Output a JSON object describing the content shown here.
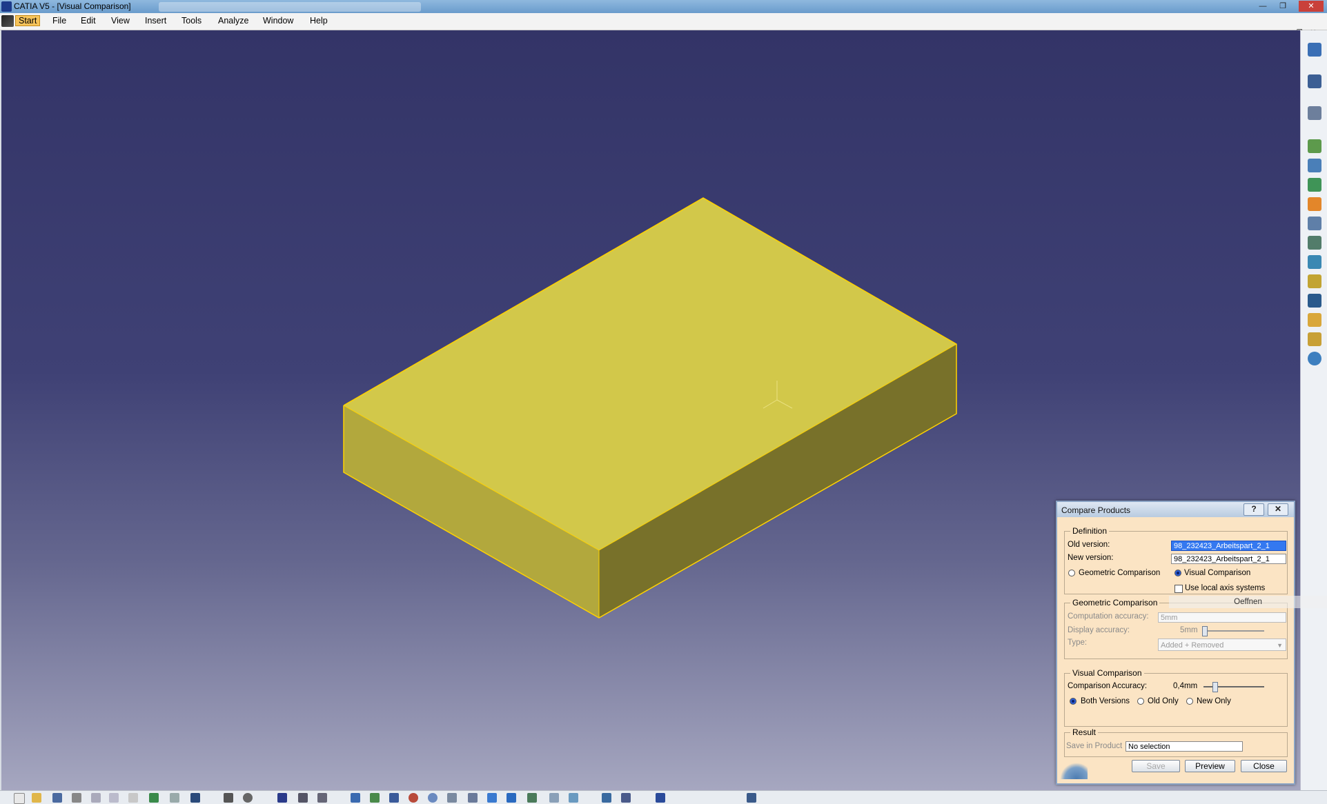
{
  "window": {
    "title": "CATIA V5 - [Visual Comparison]",
    "controls": {
      "minimize": "—",
      "maximize": "❐",
      "close": "✕"
    }
  },
  "menu": {
    "items": [
      "Start",
      "File",
      "Edit",
      "View",
      "Insert",
      "Tools",
      "Analyze",
      "Window",
      "Help"
    ]
  },
  "doc_controls": {
    "minimize": "–",
    "restore": "❐",
    "close": "✕"
  },
  "colors": {
    "viewport_top": "#333467",
    "viewport_bottom": "#a6a7c0",
    "part_top": "#d2c84a",
    "part_left": "#b2a83d",
    "part_right": "#78712a",
    "edge_highlight": "#ffd200"
  },
  "dialog": {
    "title": "Compare Products",
    "help_button": "?",
    "close_button": "✕",
    "definition": {
      "label": "Definition",
      "old_version_label": "Old version:",
      "old_version_value": "98_232423_Arbeitspart_2_1",
      "new_version_label": "New version:",
      "new_version_value": "98_232423_Arbeitspart_2_1",
      "geometric_option": "Geometric Comparison",
      "visual_option": "Visual Comparison",
      "selected_mode": "Visual Comparison",
      "local_axis_label": "Use local axis systems",
      "local_axis_checked": false
    },
    "geometric": {
      "label": "Geometric Comparison",
      "computation_accuracy_label": "Computation accuracy:",
      "computation_accuracy_value": "5mm",
      "display_accuracy_label": "Display accuracy:",
      "display_accuracy_value": "5mm",
      "type_label": "Type:",
      "type_value": "Added + Removed"
    },
    "visual": {
      "label": "Visual Comparison",
      "comparison_accuracy_label": "Comparison Accuracy:",
      "comparison_accuracy_value": "0,4mm",
      "options": [
        "Both Versions",
        "Old Only",
        "New Only"
      ],
      "selected_option": "Both Versions"
    },
    "result": {
      "label": "Result",
      "save_in_product_label": "Save in Product",
      "save_in_product_value": "No selection"
    },
    "buttons": {
      "save": "Save",
      "preview": "Preview",
      "close": "Close"
    }
  },
  "tooltip_ghost": "Oeffnen",
  "right_toolbar_icons": [
    "app-switch-icon",
    "select-arrow-icon",
    "snap-icon",
    "compare-icon",
    "product-icon",
    "assembly-icon",
    "explode-icon",
    "measure-icon",
    "sectioning-icon",
    "clash-icon",
    "annotation-icon",
    "text-icon",
    "2d-view-icon",
    "2d-view-alt-icon",
    "globe-icon"
  ],
  "bottom_toolbar_icons": [
    "new-icon",
    "open-icon",
    "save-icon",
    "print-icon",
    "cut-icon",
    "copy-icon",
    "paste-icon",
    "undo-icon",
    "redo-icon",
    "help-icon",
    "fly-icon",
    "compass-icon",
    "table-icon",
    "shading-icon",
    "measure-icon",
    "fit-all-icon",
    "pan-icon",
    "rotate-icon",
    "zoom-in-icon",
    "zoom-out-icon",
    "normal-view-icon",
    "iso-view-icon",
    "3d-view-icon",
    "hide-show-icon",
    "swap-icon",
    "render-icon",
    "render-alt-icon",
    "material-icon",
    "layer-icon",
    "update-icon",
    "refresh-icon"
  ]
}
